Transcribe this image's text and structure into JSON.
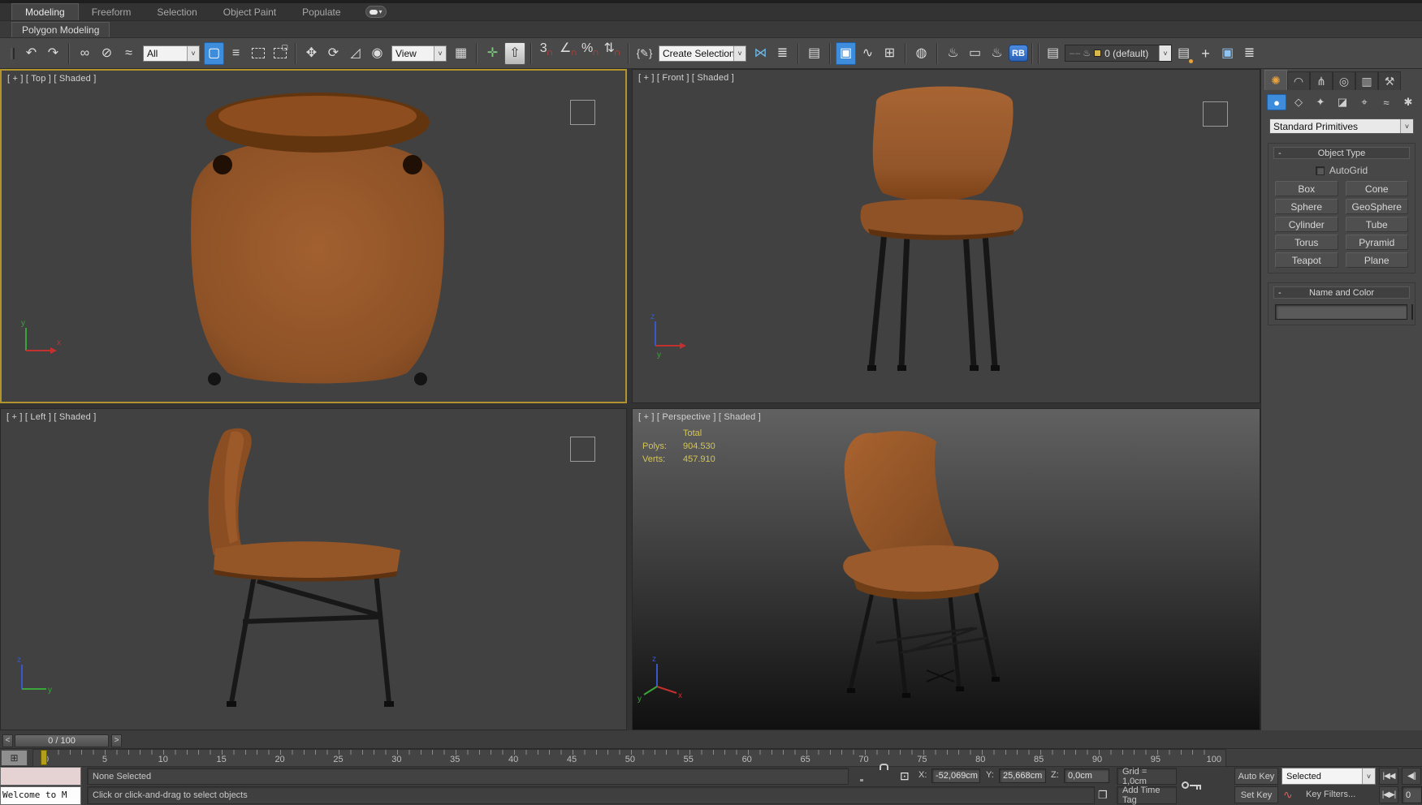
{
  "ribbon": {
    "tabs": [
      {
        "label": "Modeling",
        "active": true
      },
      {
        "label": "Freeform",
        "active": false
      },
      {
        "label": "Selection",
        "active": false
      },
      {
        "label": "Object Paint",
        "active": false
      },
      {
        "label": "Populate",
        "active": false
      }
    ],
    "panel_label": "Polygon Modeling"
  },
  "toolbar": {
    "filter_dropdown": "All",
    "coord_dropdown": "View",
    "selection_set_value": "Create Selection Se",
    "layer_dropdown": "0 (default)",
    "icons": {
      "dropdown-arrow-icon": "˅",
      "ribbon-overflow-icon": "▾",
      "undo-icon": "↶",
      "redo-icon": "↷",
      "select-link-icon": "∞",
      "unlink-icon": "⊘",
      "bind-spacewarp-icon": "≈",
      "select-object-icon": "▢",
      "select-by-name-icon": "≡",
      "window-crossing-icon": "▢",
      "move-icon": "✥",
      "rotate-icon": "⟳",
      "scale-icon": "◿",
      "manipulate-icon": "◉",
      "pivot-icon": "▦",
      "manip-cross-icon": "✛",
      "keyboard-override-icon": "⇧",
      "snap-3d-icon": "3",
      "snap-angle-icon": "∠",
      "snap-percent-icon": "%",
      "snap-spinner-icon": "⇅",
      "snap-magnet-icon": "∩",
      "named-sets-icon": "{✎}",
      "mirror-icon": "⋈",
      "align-icon": "≣",
      "layer-manager-icon": "▤",
      "scene-explorer-icon": "▣",
      "curve-editor-icon": "∿",
      "schematic-icon": "⊞",
      "material-editor-icon": "◍",
      "render-setup-icon": "♨",
      "rendered-frame-icon": "▭",
      "render-icon": "♨",
      "render-badge": "RB",
      "layer-icon": "▤",
      "layer-glow-icon": "▤",
      "add-layer-icon": "+",
      "isolate-icon": "▣",
      "select-similar-icon": "≣",
      "tab-create-icon": "✺",
      "tab-modify-icon": "◠",
      "tab-hierarchy-icon": "⋔",
      "tab-motion-icon": "◎",
      "tab-display-icon": "▥",
      "tab-utilities-icon": "⚒",
      "cat-geometry-icon": "●",
      "cat-shapes-icon": "◇",
      "cat-lights-icon": "✦",
      "cat-cameras-icon": "◪",
      "cat-helpers-icon": "⌖",
      "cat-spacewarps-icon": "≈",
      "cat-systems-icon": "✱",
      "abs-mode-icon": "⊡",
      "window-icon": "❐",
      "go-start-icon": "|◀◀",
      "prev-frame-icon": "◀||",
      "key-mode-icon": "|◀▶|",
      "set-key-curve-icon": "∿",
      "trackbar-button-icon": "⊞"
    }
  },
  "viewports": {
    "top": {
      "label": "[ + ] [ Top ] [ Shaded ]"
    },
    "front": {
      "label": "[ + ] [ Front ] [ Shaded ]"
    },
    "left": {
      "label": "[ + ] [ Left ] [ Shaded ]"
    },
    "perspective": {
      "label": "[ + ] [ Perspective ] [ Shaded ]",
      "stats": {
        "total_label": "Total",
        "polys_label": "Polys:",
        "polys_value": "904.530",
        "verts_label": "Verts:",
        "verts_value": "457.910"
      }
    },
    "axis": {
      "x": "x",
      "y": "y",
      "z": "z"
    }
  },
  "command_panel": {
    "category_dropdown": "Standard Primitives",
    "object_type": {
      "collapse": "-",
      "title": "Object Type",
      "autogrid_label": "AutoGrid",
      "buttons": [
        "Box",
        "Cone",
        "Sphere",
        "GeoSphere",
        "Cylinder",
        "Tube",
        "Torus",
        "Pyramid",
        "Teapot",
        "Plane"
      ]
    },
    "name_color": {
      "collapse": "-",
      "title": "Name and Color",
      "name_value": "",
      "swatch_color": "#d6338f"
    }
  },
  "timeline": {
    "prev": "<",
    "next": ">",
    "slider_label": "0 / 100",
    "tick_labels": [
      "0",
      "5",
      "10",
      "15",
      "20",
      "25",
      "30",
      "35",
      "40",
      "45",
      "50",
      "55",
      "60",
      "65",
      "70",
      "75",
      "80",
      "85",
      "90",
      "95",
      "100"
    ]
  },
  "status_bar": {
    "listener_text": "Welcome to M",
    "selection_status": "None Selected",
    "prompt": "Click or click-and-drag to select objects",
    "x_label": "X:",
    "x_value": "-52,069cm",
    "y_label": "Y:",
    "y_value": "25,668cm",
    "z_label": "Z:",
    "z_value": "0,0cm",
    "grid_label": "Grid = 1,0cm",
    "add_time_tag": "Add Time Tag",
    "auto_key": "Auto Key",
    "set_key": "Set Key",
    "selected_dropdown": "Selected",
    "key_filters": "Key Filters...",
    "frame_value": "0"
  },
  "colors": {
    "selection_blue": "#3e8ddd",
    "active_viewport_border": "#b2942c",
    "stats_yellow": "#d4c455",
    "name_swatch": "#d6338f",
    "chair_leather": "#9a5a2a",
    "timeline_marker": "#b3a018"
  }
}
